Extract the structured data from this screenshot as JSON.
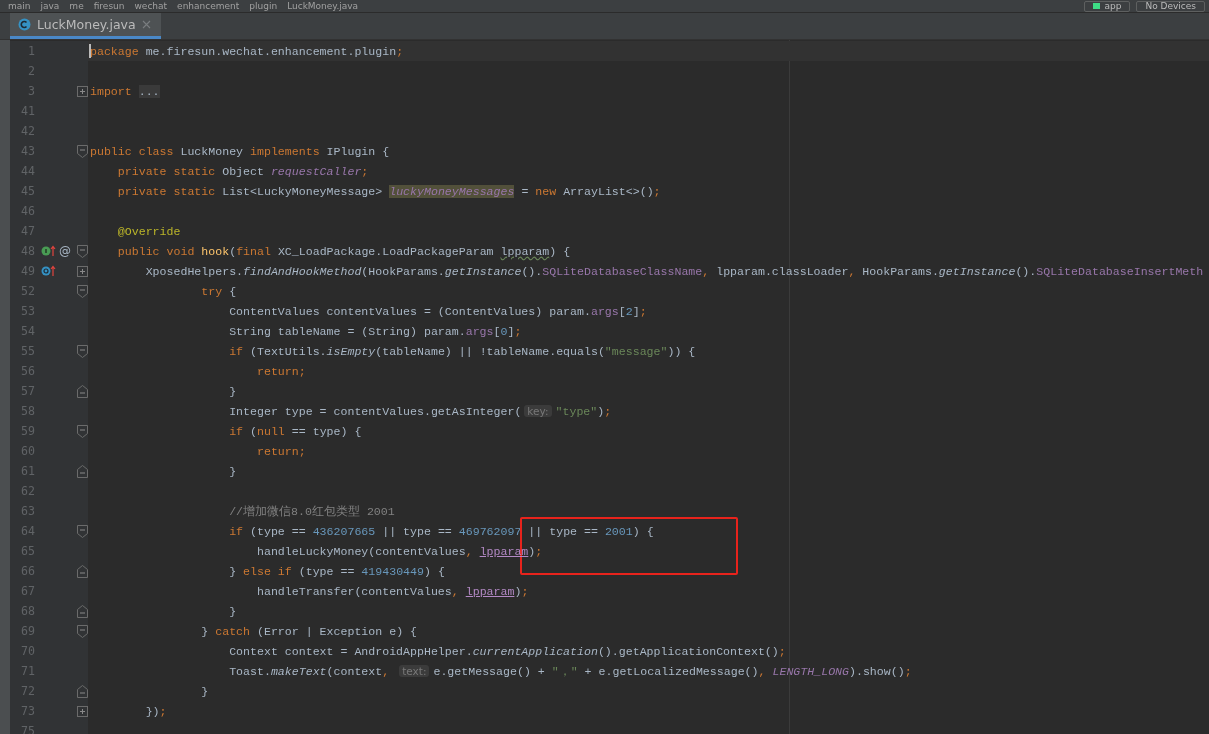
{
  "breadcrumb": [
    "main",
    "java",
    "me",
    "firesun",
    "wechat",
    "enhancement",
    "plugin",
    "LuckMoney.java"
  ],
  "run_config": {
    "module": "app",
    "device": "No Devices"
  },
  "tabs": [
    {
      "label": "LuckMoney.java",
      "selected": true
    }
  ],
  "lines": [
    {
      "n": "1",
      "caret": true,
      "tokens": [
        {
          "t": "package",
          "kind": "kw"
        },
        {
          "t": " me.firesun.wechat.enhancement.plugin",
          "kind": "p"
        },
        {
          "t": ";",
          "kind": "kw"
        }
      ]
    },
    {
      "n": "2"
    },
    {
      "n": "3",
      "fold": {
        "kind": "plus"
      },
      "tokens": [
        {
          "t": "import ",
          "kind": "kw"
        },
        {
          "t": "...",
          "kind": "fold"
        }
      ]
    },
    {
      "n": "41"
    },
    {
      "n": "42"
    },
    {
      "n": "43",
      "fold": {
        "kind": "start"
      },
      "tokens": [
        {
          "t": "public class ",
          "kind": "kw"
        },
        {
          "t": "LuckMoney ",
          "kind": "p"
        },
        {
          "t": "implements ",
          "kind": "kw"
        },
        {
          "t": "IPlugin {",
          "kind": "p"
        }
      ]
    },
    {
      "n": "44",
      "tokens": [
        {
          "t": "    private static ",
          "kind": "kw"
        },
        {
          "t": "Object ",
          "kind": "p"
        },
        {
          "t": "requestCaller",
          "kind": "fldi"
        },
        {
          "t": ";",
          "kind": "kw"
        }
      ]
    },
    {
      "n": "45",
      "tokens": [
        {
          "t": "    private static ",
          "kind": "kw"
        },
        {
          "t": "List<LuckyMoneyMessage> ",
          "kind": "p"
        },
        {
          "t": "luckyMoneyMessages",
          "kind": "fldhl"
        },
        {
          "t": " = ",
          "kind": "p"
        },
        {
          "t": "new ",
          "kind": "kw"
        },
        {
          "t": "ArrayList<>()",
          "kind": "p"
        },
        {
          "t": ";",
          "kind": "kw"
        }
      ]
    },
    {
      "n": "46"
    },
    {
      "n": "47",
      "tokens": [
        {
          "t": "    @Override",
          "kind": "ann"
        }
      ]
    },
    {
      "n": "48",
      "fold": {
        "kind": "start"
      },
      "marks": [
        {
          "kind": "implements"
        },
        {
          "kind": "glyph",
          "text": "@"
        }
      ],
      "tokens": [
        {
          "t": "    public void ",
          "kind": "kw"
        },
        {
          "t": "hook",
          "kind": "decl"
        },
        {
          "t": "(",
          "kind": "p"
        },
        {
          "t": "final ",
          "kind": "kw"
        },
        {
          "t": "XC_LoadPackage.LoadPackageParam ",
          "kind": "p"
        },
        {
          "t": "lpparam",
          "kind": "wavy"
        },
        {
          "t": ") {",
          "kind": "p"
        }
      ]
    },
    {
      "n": "49",
      "fold": {
        "kind": "plus"
      },
      "marks": [
        {
          "kind": "overrides"
        }
      ],
      "tokens": [
        {
          "t": "        XposedHelpers.",
          "kind": "p"
        },
        {
          "t": "findAndHookMethod",
          "kind": "it"
        },
        {
          "t": "(HookParams.",
          "kind": "p"
        },
        {
          "t": "getInstance",
          "kind": "it"
        },
        {
          "t": "().",
          "kind": "p"
        },
        {
          "t": "SQLiteDatabaseClassName",
          "kind": "fld"
        },
        {
          "t": ", ",
          "kind": "kw"
        },
        {
          "t": "lpparam.classLoader",
          "kind": "p"
        },
        {
          "t": ", ",
          "kind": "kw"
        },
        {
          "t": "HookParams.",
          "kind": "p"
        },
        {
          "t": "getInstance",
          "kind": "it"
        },
        {
          "t": "().",
          "kind": "p"
        },
        {
          "t": "SQLiteDatabaseInsertMeth",
          "kind": "fld"
        }
      ]
    },
    {
      "n": "52",
      "fold": {
        "kind": "start"
      },
      "tokens": [
        {
          "t": "                try ",
          "kind": "kw"
        },
        {
          "t": "{",
          "kind": "p"
        }
      ]
    },
    {
      "n": "53",
      "tokens": [
        {
          "t": "                    ContentValues contentValues = (ContentValues) param.",
          "kind": "p"
        },
        {
          "t": "args",
          "kind": "fld"
        },
        {
          "t": "[",
          "kind": "p"
        },
        {
          "t": "2",
          "kind": "num"
        },
        {
          "t": "]",
          "kind": "p"
        },
        {
          "t": ";",
          "kind": "kw"
        }
      ]
    },
    {
      "n": "54",
      "tokens": [
        {
          "t": "                    String tableName = (String) param.",
          "kind": "p"
        },
        {
          "t": "args",
          "kind": "fld"
        },
        {
          "t": "[",
          "kind": "p"
        },
        {
          "t": "0",
          "kind": "num"
        },
        {
          "t": "]",
          "kind": "p"
        },
        {
          "t": ";",
          "kind": "kw"
        }
      ]
    },
    {
      "n": "55",
      "fold": {
        "kind": "start"
      },
      "tokens": [
        {
          "t": "                    if ",
          "kind": "kw"
        },
        {
          "t": "(TextUtils.",
          "kind": "p"
        },
        {
          "t": "isEmpty",
          "kind": "it"
        },
        {
          "t": "(tableName) || !tableName.equals(",
          "kind": "p"
        },
        {
          "t": "\"message\"",
          "kind": "str"
        },
        {
          "t": ")) {",
          "kind": "p"
        }
      ]
    },
    {
      "n": "56",
      "tokens": [
        {
          "t": "                        return;",
          "kind": "kw"
        }
      ]
    },
    {
      "n": "57",
      "fold": {
        "kind": "end"
      },
      "tokens": [
        {
          "t": "                    }",
          "kind": "p"
        }
      ]
    },
    {
      "n": "58",
      "tokens": [
        {
          "t": "                    Integer type = contentValues.getAsInteger(",
          "kind": "p"
        },
        {
          "t": "key:",
          "kind": "hint"
        },
        {
          "t": "\"type\"",
          "kind": "str"
        },
        {
          "t": ")",
          "kind": "p"
        },
        {
          "t": ";",
          "kind": "kw"
        }
      ]
    },
    {
      "n": "59",
      "fold": {
        "kind": "start"
      },
      "tokens": [
        {
          "t": "                    if ",
          "kind": "kw"
        },
        {
          "t": "(",
          "kind": "p"
        },
        {
          "t": "null ",
          "kind": "kw"
        },
        {
          "t": "== type) {",
          "kind": "p"
        }
      ]
    },
    {
      "n": "60",
      "tokens": [
        {
          "t": "                        return;",
          "kind": "kw"
        }
      ]
    },
    {
      "n": "61",
      "fold": {
        "kind": "end"
      },
      "tokens": [
        {
          "t": "                    }",
          "kind": "p"
        }
      ]
    },
    {
      "n": "62"
    },
    {
      "n": "63",
      "tokens": [
        {
          "t": "                    //增加微信8.0红包类型 2001",
          "kind": "cm"
        }
      ]
    },
    {
      "n": "64",
      "boxed": true,
      "fold": {
        "kind": "start"
      },
      "tokens": [
        {
          "t": "                    if ",
          "kind": "kw"
        },
        {
          "t": "(type == ",
          "kind": "p"
        },
        {
          "t": "436207665",
          "kind": "num"
        },
        {
          "t": " || type == ",
          "kind": "p"
        },
        {
          "t": "469762097",
          "kind": "num"
        },
        {
          "t": " || type == ",
          "kind": "p"
        },
        {
          "t": "2001",
          "kind": "num"
        },
        {
          "t": ") {",
          "kind": "p"
        }
      ]
    },
    {
      "n": "65",
      "tokens": [
        {
          "t": "                        handleLuckyMoney(contentValues",
          "kind": "p"
        },
        {
          "t": ", ",
          "kind": "kw"
        },
        {
          "t": "lpparam",
          "kind": "param"
        },
        {
          "t": ")",
          "kind": "p"
        },
        {
          "t": ";",
          "kind": "kw"
        }
      ]
    },
    {
      "n": "66",
      "fold": {
        "kind": "end"
      },
      "tokens": [
        {
          "t": "                    } ",
          "kind": "p"
        },
        {
          "t": "else if ",
          "kind": "kw"
        },
        {
          "t": "(type == ",
          "kind": "p"
        },
        {
          "t": "419430449",
          "kind": "num"
        },
        {
          "t": ") {",
          "kind": "p"
        }
      ]
    },
    {
      "n": "67",
      "tokens": [
        {
          "t": "                        handleTransfer(contentValues",
          "kind": "p"
        },
        {
          "t": ", ",
          "kind": "kw"
        },
        {
          "t": "lpparam",
          "kind": "param"
        },
        {
          "t": ")",
          "kind": "p"
        },
        {
          "t": ";",
          "kind": "kw"
        }
      ]
    },
    {
      "n": "68",
      "fold": {
        "kind": "end"
      },
      "tokens": [
        {
          "t": "                    }",
          "kind": "p"
        }
      ]
    },
    {
      "n": "69",
      "fold": {
        "kind": "start"
      },
      "tokens": [
        {
          "t": "                } ",
          "kind": "p"
        },
        {
          "t": "catch ",
          "kind": "kw"
        },
        {
          "t": "(Error | Exception e) {",
          "kind": "p"
        }
      ]
    },
    {
      "n": "70",
      "tokens": [
        {
          "t": "                    Context context = AndroidAppHelper.",
          "kind": "p"
        },
        {
          "t": "currentApplication",
          "kind": "it"
        },
        {
          "t": "().getApplicationContext()",
          "kind": "p"
        },
        {
          "t": ";",
          "kind": "kw"
        }
      ]
    },
    {
      "n": "71",
      "tokens": [
        {
          "t": "                    Toast.",
          "kind": "p"
        },
        {
          "t": "makeText",
          "kind": "it"
        },
        {
          "t": "(context",
          "kind": "p"
        },
        {
          "t": ", ",
          "kind": "kw"
        },
        {
          "t": "text:",
          "kind": "hint"
        },
        {
          "t": "e.getMessage() + ",
          "kind": "p"
        },
        {
          "t": "\"，\"",
          "kind": "str"
        },
        {
          "t": " + e.getLocalizedMessage()",
          "kind": "p"
        },
        {
          "t": ", ",
          "kind": "kw"
        },
        {
          "t": "LENGTH_LONG",
          "kind": "fldi"
        },
        {
          "t": ").show()",
          "kind": "p"
        },
        {
          "t": ";",
          "kind": "kw"
        }
      ]
    },
    {
      "n": "72",
      "fold": {
        "kind": "end"
      },
      "tokens": [
        {
          "t": "                }",
          "kind": "p"
        }
      ]
    },
    {
      "n": "73",
      "fold": {
        "kind": "plus"
      },
      "tokens": [
        {
          "t": "        })",
          "kind": "p"
        },
        {
          "t": ";",
          "kind": "kw"
        }
      ]
    },
    {
      "n": "75"
    }
  ]
}
